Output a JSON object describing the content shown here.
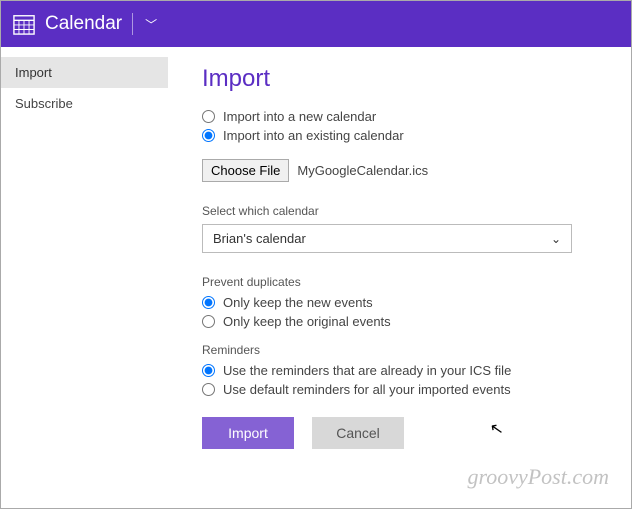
{
  "header": {
    "app_title": "Calendar"
  },
  "sidebar": {
    "items": [
      {
        "label": "Import",
        "active": true
      },
      {
        "label": "Subscribe",
        "active": false
      }
    ]
  },
  "main": {
    "title": "Import",
    "import_mode": {
      "option_new": "Import into a new calendar",
      "option_existing": "Import into an existing calendar",
      "selected": "existing"
    },
    "file": {
      "button_label": "Choose File",
      "filename": "MyGoogleCalendar.ics"
    },
    "calendar_select": {
      "label": "Select which calendar",
      "value": "Brian's calendar"
    },
    "duplicates": {
      "label": "Prevent duplicates",
      "option_new": "Only keep the new events",
      "option_original": "Only keep the original events",
      "selected": "new"
    },
    "reminders": {
      "label": "Reminders",
      "option_ics": "Use the reminders that are already in your ICS file",
      "option_default": "Use default reminders for all your imported events",
      "selected": "ics"
    },
    "buttons": {
      "import": "Import",
      "cancel": "Cancel"
    }
  },
  "watermark": "groovyPost.com"
}
